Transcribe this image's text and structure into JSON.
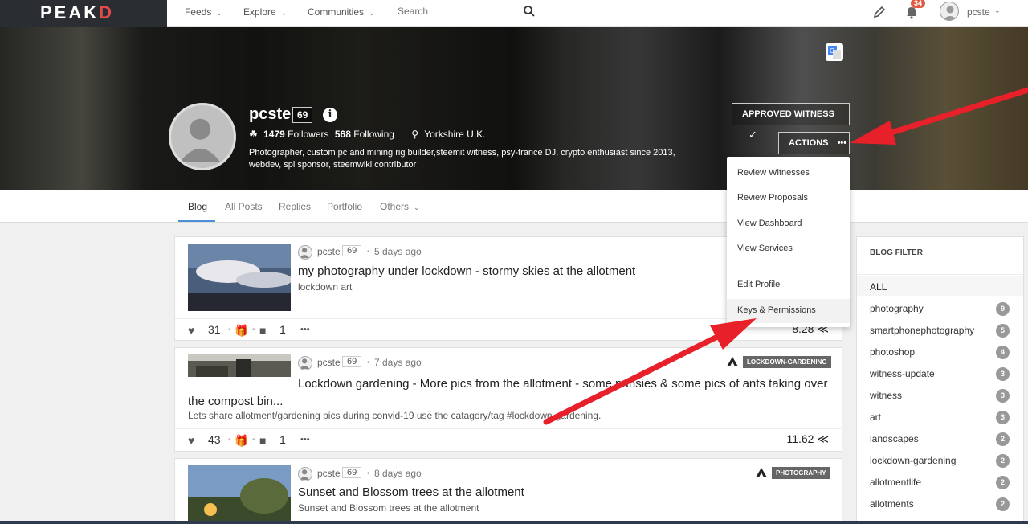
{
  "nav": {
    "logo_main": "PEAK",
    "logo_accent": "D",
    "items": [
      {
        "label": "Feeds"
      },
      {
        "label": "Explore"
      },
      {
        "label": "Communities"
      }
    ],
    "search_placeholder": "Search",
    "notification_count": "34",
    "username": "pcste"
  },
  "profile": {
    "name": "pcste",
    "reputation": "69",
    "followers_count": "1479",
    "followers_label": "Followers",
    "following_count": "568",
    "following_label": "Following",
    "location": "Yorkshire U.K.",
    "bio": "Photographer, custom pc and mining rig builder,steemit witness, psy-trance DJ, crypto enthusiast since 2013, webdev, spl sponsor, steemwiki contributor",
    "approved_witness_label": "APPROVED WITNESS",
    "actions_label": "ACTIONS"
  },
  "tabs": [
    "Blog",
    "All Posts",
    "Replies",
    "Portfolio",
    "Others"
  ],
  "actions_menu": {
    "items": [
      "Review Witnesses",
      "Review Proposals",
      "View Dashboard",
      "View Services",
      "Edit Profile",
      "Keys & Permissions"
    ]
  },
  "posts": [
    {
      "author": "pcste",
      "rep": "69",
      "ago": "5 days ago",
      "title": "my photography under lockdown - stormy skies at the allotment",
      "summary": "lockdown art",
      "votes": "31",
      "comments": "1",
      "payout": "8.28"
    },
    {
      "author": "pcste",
      "rep": "69",
      "ago": "7 days ago",
      "tag": "LOCKDOWN-GARDENING",
      "title": "Lockdown gardening - More pics from the allotment - some pansies & some pics of ants taking over the compost bin...",
      "summary": "Lets share allotment/gardening pics during convid-19 use the catagory/tag #lockdown-gardening.",
      "votes": "43",
      "comments": "1",
      "payout": "11.62"
    },
    {
      "author": "pcste",
      "rep": "69",
      "ago": "8 days ago",
      "tag": "PHOTOGRAPHY",
      "title": "Sunset and Blossom trees at the allotment",
      "summary": "Sunset and Blossom trees at the allotment"
    }
  ],
  "blog_filter": {
    "heading": "BLOG FILTER",
    "all_label": "ALL",
    "items": [
      {
        "name": "photography",
        "count": "9"
      },
      {
        "name": "smartphonephotography",
        "count": "5"
      },
      {
        "name": "photoshop",
        "count": "4"
      },
      {
        "name": "witness-update",
        "count": "3"
      },
      {
        "name": "witness",
        "count": "3"
      },
      {
        "name": "art",
        "count": "3"
      },
      {
        "name": "landscapes",
        "count": "2"
      },
      {
        "name": "lockdown-gardening",
        "count": "2"
      },
      {
        "name": "allotmentlife",
        "count": "2"
      },
      {
        "name": "allotments",
        "count": "2"
      }
    ]
  },
  "colors": {
    "accent_red": "#e44a4a",
    "arrow_red": "#e8202a",
    "tab_underline": "#4a90d9",
    "badge": "#e05a44"
  }
}
